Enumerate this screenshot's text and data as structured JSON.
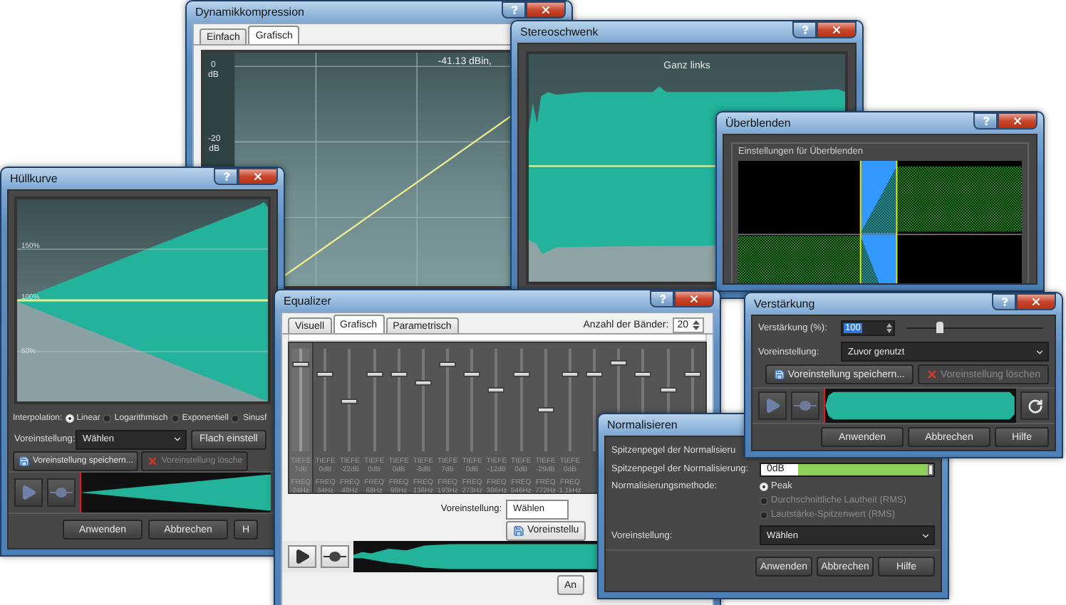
{
  "dynamikkompression": {
    "title": "Dynamikkompression",
    "tabs": [
      {
        "label": "Einfach",
        "selected": false
      },
      {
        "label": "Grafisch",
        "selected": true
      }
    ],
    "readout": "-41.13 dBin,",
    "axis_labels": [
      "0 dB",
      "-20 dB"
    ]
  },
  "stereoschwenk": {
    "title": "Stereoschwenk",
    "position": "Ganz links"
  },
  "ueberblenden": {
    "title": "Überblenden",
    "group": "Einstellungen für Überblenden"
  },
  "huellkurve": {
    "title": "Hüllkurve",
    "graph_labels": [
      "150%",
      "100%",
      "50%"
    ],
    "interpolation": {
      "label": "Interpolation:",
      "options": [
        {
          "label": "Linear",
          "selected": true
        },
        {
          "label": "Logarithmisch",
          "selected": false
        },
        {
          "label": "Exponentiell",
          "selected": false
        },
        {
          "label": "Sinusf",
          "selected": false
        }
      ]
    },
    "preset": {
      "label": "Voreinstellung:",
      "value": "Wählen",
      "button": "Flach einstell"
    },
    "preset_buttons": [
      {
        "kind": "save",
        "label": "Voreinstellung speichern...",
        "disabled": false
      },
      {
        "kind": "delete",
        "label": "Voreinstellung lösche",
        "disabled": true
      }
    ],
    "dialog_buttons": [
      "Anwenden",
      "Abbrechen",
      "H"
    ]
  },
  "equalizer": {
    "title": "Equalizer",
    "tabs": [
      {
        "label": "Visuell",
        "selected": false
      },
      {
        "label": "Grafisch",
        "selected": true
      },
      {
        "label": "Parametrisch",
        "selected": false
      }
    ],
    "band_count": {
      "label": "Anzahl der Bänder:",
      "value": "20"
    },
    "bands": [
      {
        "tiefe_label": "TIEFE",
        "tiefe": "7dB",
        "freq_label": "FREQ",
        "freq": "24Hz",
        "level": 0.85,
        "selected": true
      },
      {
        "tiefe_label": "TIEFE",
        "tiefe": "0dB",
        "freq_label": "FREQ",
        "freq": "34Hz",
        "level": 0.75,
        "selected": false
      },
      {
        "tiefe_label": "TIEFE",
        "tiefe": "-22dB",
        "freq_label": "FREQ",
        "freq": "48Hz",
        "level": 0.49,
        "selected": false
      },
      {
        "tiefe_label": "TIEFE",
        "tiefe": "0dB",
        "freq_label": "FREQ",
        "freq": "68Hz",
        "level": 0.75,
        "selected": false
      },
      {
        "tiefe_label": "TIEFE",
        "tiefe": "0dB",
        "freq_label": "FREQ",
        "freq": "96Hz",
        "level": 0.75,
        "selected": false
      },
      {
        "tiefe_label": "TIEFE",
        "tiefe": "-8dB",
        "freq_label": "FREQ",
        "freq": "136Hz",
        "level": 0.66,
        "selected": false
      },
      {
        "tiefe_label": "TIEFE",
        "tiefe": "7dB",
        "freq_label": "FREQ",
        "freq": "193Hz",
        "level": 0.85,
        "selected": false
      },
      {
        "tiefe_label": "TIEFE",
        "tiefe": "0dB",
        "freq_label": "FREQ",
        "freq": "273Hz",
        "level": 0.75,
        "selected": false
      },
      {
        "tiefe_label": "TIEFE",
        "tiefe": "-12dB",
        "freq_label": "FREQ",
        "freq": "386Hz",
        "level": 0.6,
        "selected": false
      },
      {
        "tiefe_label": "TIEFE",
        "tiefe": "0dB",
        "freq_label": "FREQ",
        "freq": "546Hz",
        "level": 0.75,
        "selected": false
      },
      {
        "tiefe_label": "TIEFE",
        "tiefe": "-29dB",
        "freq_label": "FREQ",
        "freq": "772Hz",
        "level": 0.4,
        "selected": false
      },
      {
        "tiefe_label": "TIEFE",
        "tiefe": "0dB",
        "freq_label": "FREQ",
        "freq": "1.1kHz",
        "level": 0.75,
        "selected": false
      },
      {
        "level": 0.75,
        "selected": false
      },
      {
        "level": 0.86,
        "selected": false
      },
      {
        "level": 0.75,
        "selected": false
      },
      {
        "level": 0.6,
        "selected": false
      },
      {
        "level": 0.75,
        "selected": false
      }
    ],
    "preset": {
      "label": "Voreinstellung:",
      "value": "Wählen"
    },
    "save_button": "Voreinstellu",
    "dialog_buttons": [
      "An"
    ]
  },
  "normalisieren": {
    "title": "Normalisieren",
    "cut_label": "Spitzenpegel der Normalisieru",
    "peak": {
      "label": "Spitzenpegel der Normalisierung:",
      "value": "0dB"
    },
    "method": {
      "label": "Normalisierungsmethode:",
      "options": [
        {
          "label": "Peak",
          "selected": true,
          "disabled": false
        },
        {
          "label": "Durchschnittliche Lautheit (RMS)",
          "selected": false,
          "disabled": true
        },
        {
          "label": "Lautstärke-Spitzenwert (RMS)",
          "selected": false,
          "disabled": true
        }
      ]
    },
    "preset": {
      "label": "Voreinstellung:",
      "value": "Wählen"
    },
    "dialog_buttons": [
      "Anwenden",
      "Abbrechen",
      "Hilfe"
    ]
  },
  "verstaerkung": {
    "title": "Verstärkung",
    "gain": {
      "label": "Verstärkung (%):",
      "value": "100",
      "level": 0.24
    },
    "preset": {
      "label": "Voreinstellung:",
      "value": "Zuvor genutzt"
    },
    "preset_buttons": [
      {
        "kind": "save",
        "label": "Voreinstellung speichern...",
        "disabled": false
      },
      {
        "kind": "delete",
        "label": "Voreinstellung löschen",
        "disabled": true
      }
    ],
    "dialog_buttons": [
      "Anwenden",
      "Abbrechen",
      "Hilfe"
    ]
  }
}
